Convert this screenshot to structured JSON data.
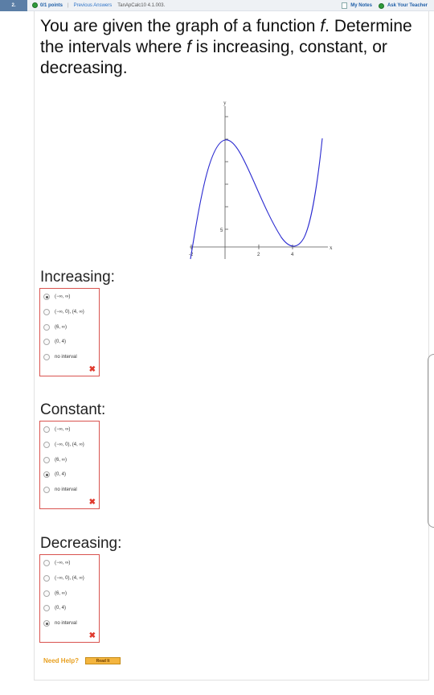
{
  "header": {
    "question_number": "2.",
    "points": "0/1 points",
    "separator": "|",
    "previous_answers": "Previous Answers",
    "reference": "TanApCalc10 4.1.003.",
    "my_notes": "My Notes",
    "ask_teacher": "Ask Your Teacher"
  },
  "question": {
    "before_f": "You are given the graph of a function ",
    "f1": "f",
    "middle": ". Determine the intervals where ",
    "f2": "f",
    "after": " is increasing, constant, or decreasing."
  },
  "graph": {
    "y_axis_label": "y",
    "x_axis_label": "x",
    "tick_x_neg2": "-2",
    "tick_x_2": "2",
    "tick_x_4": "4",
    "tick_y_5": "5"
  },
  "options": [
    "(−∞, ∞)",
    "(−∞, 0), (4, ∞)",
    "(6, ∞)",
    "(0, 4)",
    "no interval"
  ],
  "sections": [
    {
      "label": "Increasing:",
      "selected_index": 0,
      "incorrect": true
    },
    {
      "label": "Constant:",
      "selected_index": 3,
      "incorrect": true
    },
    {
      "label": "Decreasing:",
      "selected_index": 4,
      "incorrect": true
    }
  ],
  "wrong_mark": "✖",
  "help": {
    "label": "Need Help?",
    "button": "Read It"
  },
  "colors": {
    "accent_blue": "#1f5fa8",
    "curve": "#2a2ad0",
    "error_red": "#d9534f",
    "help_orange": "#e8a020"
  }
}
